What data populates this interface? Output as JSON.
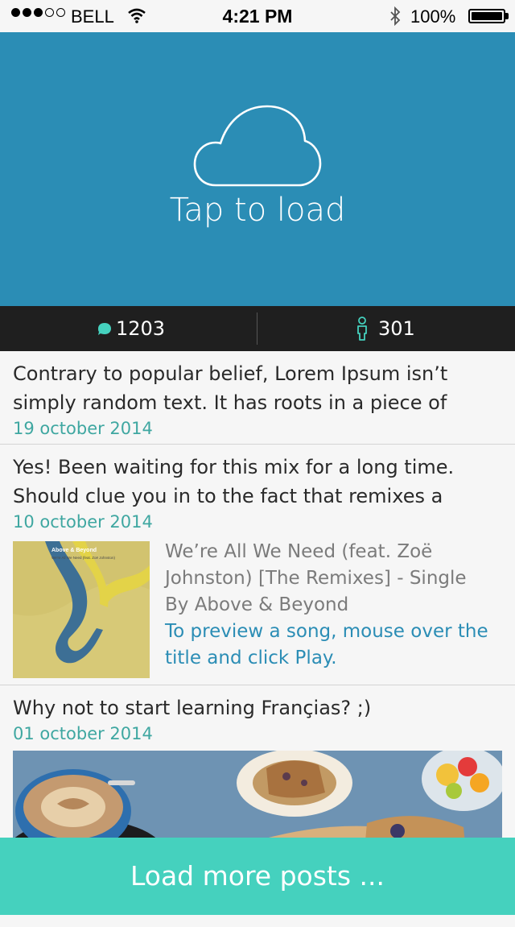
{
  "status_bar": {
    "carrier": "BELL",
    "time": "4:21 PM",
    "battery": "100%",
    "signal_filled": 3,
    "signal_total": 5
  },
  "hero": {
    "label": "Tap to load",
    "icon": "cloud-icon",
    "background": "#2b8db5"
  },
  "stats": {
    "comments": "1203",
    "users": "301",
    "accent": "#45d1be"
  },
  "posts": [
    {
      "text": "Contrary to popular belief, Lorem Ipsum isn’t simply random text. It has roots in a piece of",
      "date": "19 october 2014"
    },
    {
      "text": "Yes! Been waiting for this mix for a long time. Should clue you in to the fact that remixes a",
      "date": "10 october 2014",
      "track": {
        "title": "We’re All We Need (feat. Zoë Johnston) [The Remixes] - Single By Above & Beyond",
        "note": "To preview a song, mouse over the title and click Play.",
        "art_title": "Above & Beyond",
        "art_subtitle": "We're All We Need (feat. Zoë Johnston)"
      }
    },
    {
      "text": "Why not to start learning Françias? ;)",
      "date": "01 october 2014"
    }
  ],
  "load_more": "Load more posts ..."
}
